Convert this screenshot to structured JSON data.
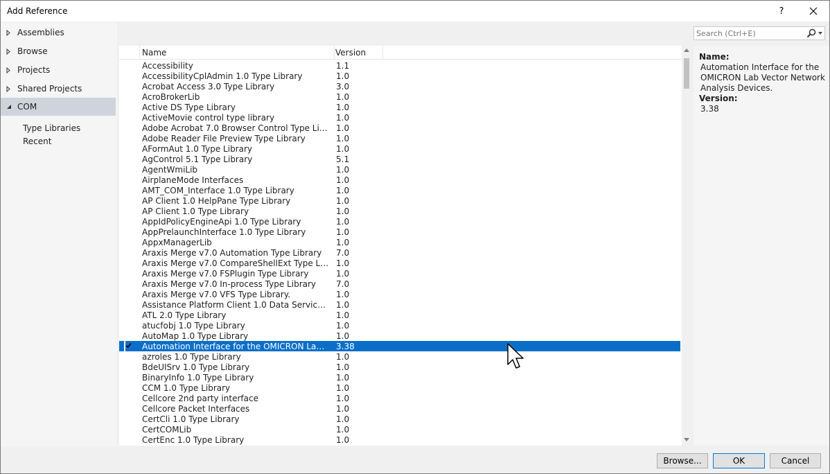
{
  "window": {
    "title": "Add Reference",
    "help_label": "?"
  },
  "nav": {
    "items": [
      {
        "label": "Assemblies",
        "expanded": false
      },
      {
        "label": "Browse",
        "expanded": false
      },
      {
        "label": "Projects",
        "expanded": false
      },
      {
        "label": "Shared Projects",
        "expanded": false
      },
      {
        "label": "COM",
        "expanded": true
      }
    ],
    "sub_items": [
      "Type Libraries",
      "Recent"
    ]
  },
  "search": {
    "placeholder": "Search (Ctrl+E)"
  },
  "list": {
    "columns": {
      "name": "Name",
      "version": "Version"
    },
    "rows": [
      {
        "name": "Accessibility",
        "version": "1.1"
      },
      {
        "name": "AccessibilityCplAdmin 1.0 Type Library",
        "version": "1.0"
      },
      {
        "name": "Acrobat Access 3.0 Type Library",
        "version": "3.0"
      },
      {
        "name": "AcroBrokerLib",
        "version": "1.0"
      },
      {
        "name": "Active DS Type Library",
        "version": "1.0"
      },
      {
        "name": "ActiveMovie control type library",
        "version": "1.0"
      },
      {
        "name": "Adobe Acrobat 7.0 Browser Control Type Library...",
        "version": "1.0"
      },
      {
        "name": "Adobe Reader File Preview Type Library",
        "version": "1.0"
      },
      {
        "name": "AFormAut 1.0 Type Library",
        "version": "1.0"
      },
      {
        "name": "AgControl 5.1 Type Library",
        "version": "5.1"
      },
      {
        "name": "AgentWmiLib",
        "version": "1.0"
      },
      {
        "name": "AirplaneMode Interfaces",
        "version": "1.0"
      },
      {
        "name": "AMT_COM_Interface 1.0 Type Library",
        "version": "1.0"
      },
      {
        "name": "AP Client 1.0 HelpPane Type Library",
        "version": "1.0"
      },
      {
        "name": "AP Client 1.0 Type Library",
        "version": "1.0"
      },
      {
        "name": "AppIdPolicyEngineApi 1.0 Type Library",
        "version": "1.0"
      },
      {
        "name": "AppPrelaunchInterface 1.0 Type Library",
        "version": "1.0"
      },
      {
        "name": "AppxManagerLib",
        "version": "1.0"
      },
      {
        "name": "Araxis Merge v7.0 Automation Type Library",
        "version": "7.0"
      },
      {
        "name": "Araxis Merge v7.0 CompareShellExt Type Library",
        "version": "1.0"
      },
      {
        "name": "Araxis Merge v7.0 FSPlugin Type Library",
        "version": "1.0"
      },
      {
        "name": "Araxis Merge v7.0 In-process Type Library",
        "version": "7.0"
      },
      {
        "name": "Araxis Merge v7.0 VFS Type Library.",
        "version": "1.0"
      },
      {
        "name": "Assistance Platform Client 1.0 Data Services Type...",
        "version": "1.0"
      },
      {
        "name": "ATL 2.0 Type Library",
        "version": "1.0"
      },
      {
        "name": "atucfobj 1.0 Type Library",
        "version": "1.0"
      },
      {
        "name": "AutoMap 1.0 Type Library",
        "version": "1.0"
      },
      {
        "name": "Automation Interface for the OMICRON Lab Vect...",
        "version": "3.38",
        "selected": true,
        "checked": true
      },
      {
        "name": "azroles 1.0 Type Library",
        "version": "1.0"
      },
      {
        "name": "BdeUISrv 1.0 Type Library",
        "version": "1.0"
      },
      {
        "name": "BinaryInfo 1.0 Type Library",
        "version": "1.0"
      },
      {
        "name": "CCM 1.0 Type Library",
        "version": "1.0"
      },
      {
        "name": "Cellcore 2nd party interface",
        "version": "1.0"
      },
      {
        "name": "Cellcore Packet Interfaces",
        "version": "1.0"
      },
      {
        "name": "CertCli 1.0 Type Library",
        "version": "1.0"
      },
      {
        "name": "CertCOMLib",
        "version": "1.0"
      },
      {
        "name": "CertEnc 1.0 Type Library",
        "version": "1.0"
      }
    ]
  },
  "details": {
    "name_label": "Name:",
    "name_value": "Automation Interface for the OMICRON Lab Vector Network Analysis Devices.",
    "version_label": "Version:",
    "version_value": "3.38"
  },
  "buttons": {
    "browse": "Browse...",
    "ok": "OK",
    "cancel": "Cancel"
  },
  "colors": {
    "selection": "#0b6fc9",
    "nav_selected": "#cfd3dc",
    "ok_border": "#0078d7"
  }
}
